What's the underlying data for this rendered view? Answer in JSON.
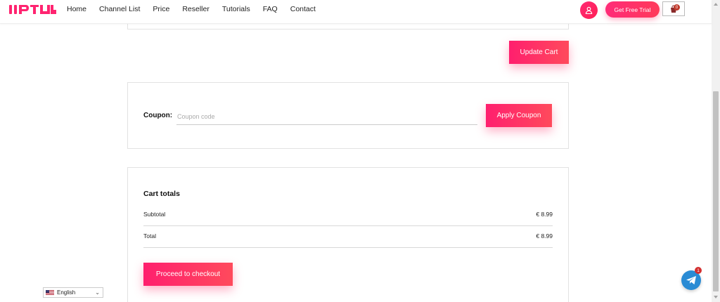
{
  "brand": {
    "logo_text": "IIPTV",
    "accent": "#ff2470"
  },
  "nav": {
    "items": [
      {
        "label": "Home"
      },
      {
        "label": "Channel List"
      },
      {
        "label": "Price"
      },
      {
        "label": "Reseller"
      },
      {
        "label": "Tutorials"
      },
      {
        "label": "FAQ"
      },
      {
        "label": "Contact"
      }
    ]
  },
  "header": {
    "user_icon": "user-icon",
    "trial_label": "Get Free Trial",
    "cart_icon": "cart-icon",
    "cart_count": "0"
  },
  "cart": {
    "update_label": "Update Cart"
  },
  "coupon": {
    "label": "Coupon:",
    "placeholder": "Coupon code",
    "apply_label": "Apply Coupon"
  },
  "totals": {
    "title": "Cart totals",
    "subtotal_label": "Subtotal",
    "subtotal_value": "€ 8.99",
    "total_label": "Total",
    "total_value": "€ 8.99",
    "checkout_label": "Proceed to checkout"
  },
  "language": {
    "selected": "English"
  },
  "telegram": {
    "icon": "telegram-icon",
    "badge": "1"
  }
}
